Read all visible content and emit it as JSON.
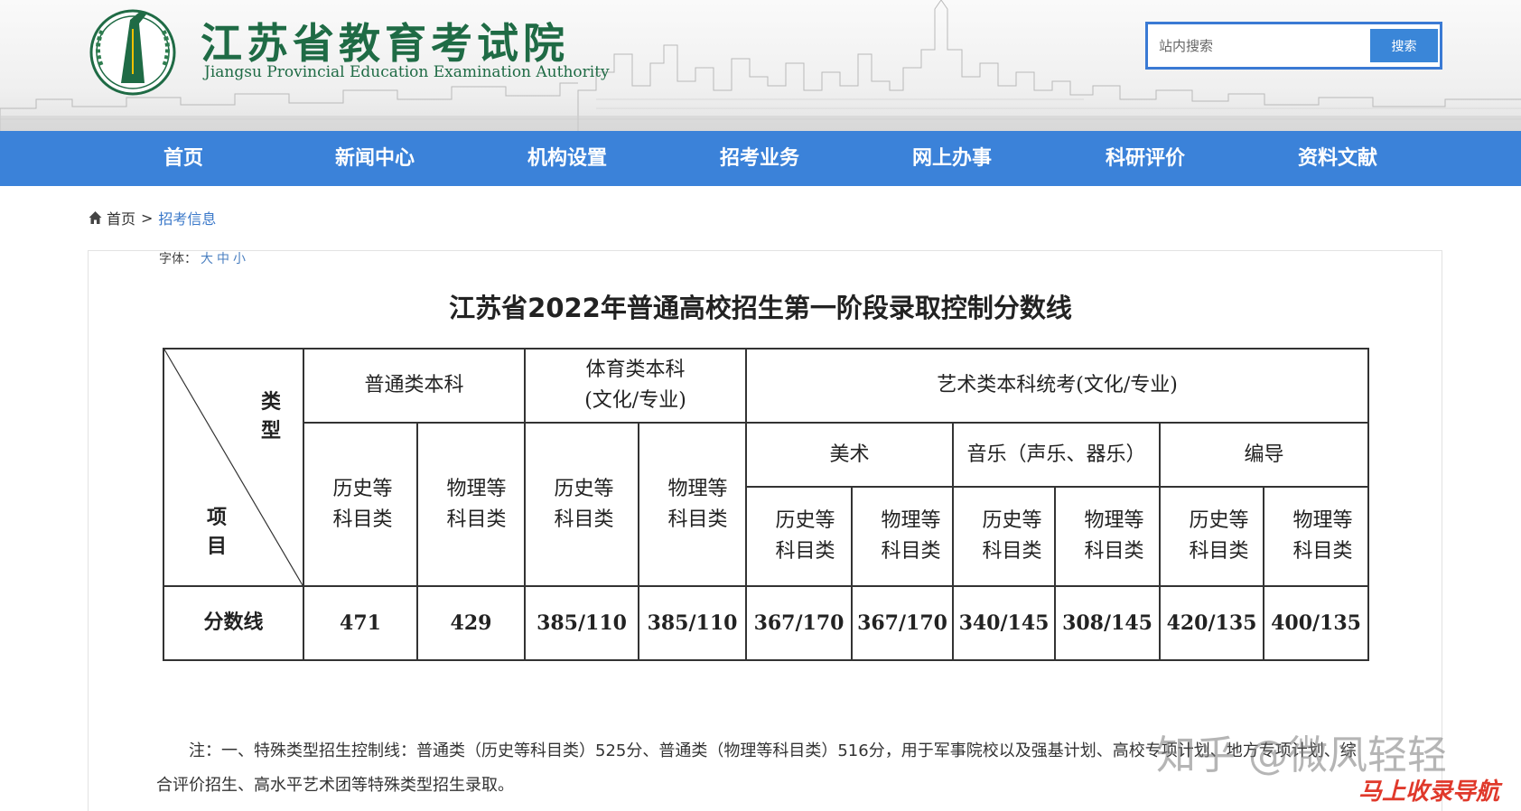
{
  "header": {
    "title_cn": "江苏省教育考试院",
    "title_en": "Jiangsu Provincial Education Examination Authority",
    "search_placeholder": "站内搜索",
    "search_button": "搜索"
  },
  "nav": {
    "items": [
      {
        "label": "首页"
      },
      {
        "label": "新闻中心"
      },
      {
        "label": "机构设置"
      },
      {
        "label": "招考业务"
      },
      {
        "label": "网上办事"
      },
      {
        "label": "科研评价"
      },
      {
        "label": "资料文献"
      }
    ]
  },
  "breadcrumb": {
    "home": "首页",
    "separator": ">",
    "current": "招考信息"
  },
  "font_size": {
    "label": "字体：",
    "options": [
      "大",
      "中",
      "小"
    ]
  },
  "article": {
    "title": "江苏省2022年普通高校招生第一阶段录取控制分数线"
  },
  "table": {
    "corner_type": "类型",
    "corner_item": "项目",
    "groups": {
      "putong": "普通类本科",
      "tiyu_line1": "体育类本科",
      "tiyu_line2": "(文化/专业)",
      "yishu": "艺术类本科统考(文化/专业)"
    },
    "subgroups": {
      "meishu": "美术",
      "yinyue": "音乐（声乐、器乐）",
      "biandao": "编导"
    },
    "category_lines": {
      "history_1": "历史等",
      "history_2": "科目类",
      "physics_1": "物理等",
      "physics_2": "科目类"
    },
    "row_label": "分数线",
    "values": [
      "471",
      "429",
      "385/110",
      "385/110",
      "367/170",
      "367/170",
      "340/145",
      "308/145",
      "420/135",
      "400/135"
    ]
  },
  "note": {
    "text": "注：一、特殊类型招生控制线：普通类（历史等科目类）525分、普通类（物理等科目类）516分，用于军事院校以及强基计划、高校专项计划、地方专项计划、综合评价招生、高水平艺术团等特殊类型招生录取。"
  },
  "watermark": {
    "text": "知乎 @微风轻轻",
    "brand": "马上收录导航"
  },
  "colors": {
    "nav_bg": "#3b82d9",
    "title_green": "#1f6b45",
    "link_blue": "#3a78c9"
  }
}
